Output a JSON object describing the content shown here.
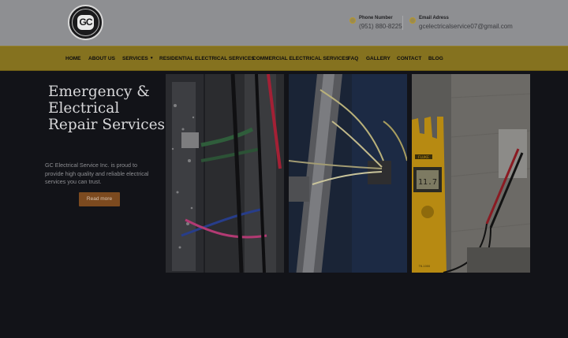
{
  "logo": {
    "mark": "GC",
    "ring_text": "GC ELECTRICAL SERVICE INC."
  },
  "contact": {
    "phone": {
      "title": "Phone Number",
      "value": "(951) 880-8225",
      "icon": "phone-icon"
    },
    "email": {
      "title": "Email Adress",
      "value": "gcelectricalservice07@gmail.com",
      "icon": "email-icon"
    }
  },
  "nav": {
    "items": [
      {
        "label": "HOME"
      },
      {
        "label": "ABOUT US"
      },
      {
        "label": "SERVICES"
      },
      {
        "label": "RESIDENTIAL ELECTRICAL SERVICES"
      },
      {
        "label": "COMMERCIAL ELECTRICAL SERVICES"
      },
      {
        "label": "FAQ"
      },
      {
        "label": "GALLERY"
      },
      {
        "label": "CONTACT"
      },
      {
        "label": "BLOG"
      }
    ],
    "dropdown_icon": "chevron-down-icon"
  },
  "hero": {
    "title": "Emergency & Electrical Repair Services",
    "text": "GC Electrical Service Inc. is proud to provide high quality and reliable electrical services you can trust.",
    "button": "Read more"
  },
  "gallery": {
    "meter_display": "11.7",
    "meter_brand": "FLUKE",
    "meter_model": "T6-1000"
  },
  "colors": {
    "top_bar": "#8e8f92",
    "nav_bar": "#85721f",
    "background": "#121318",
    "button": "#7c4a1f"
  }
}
